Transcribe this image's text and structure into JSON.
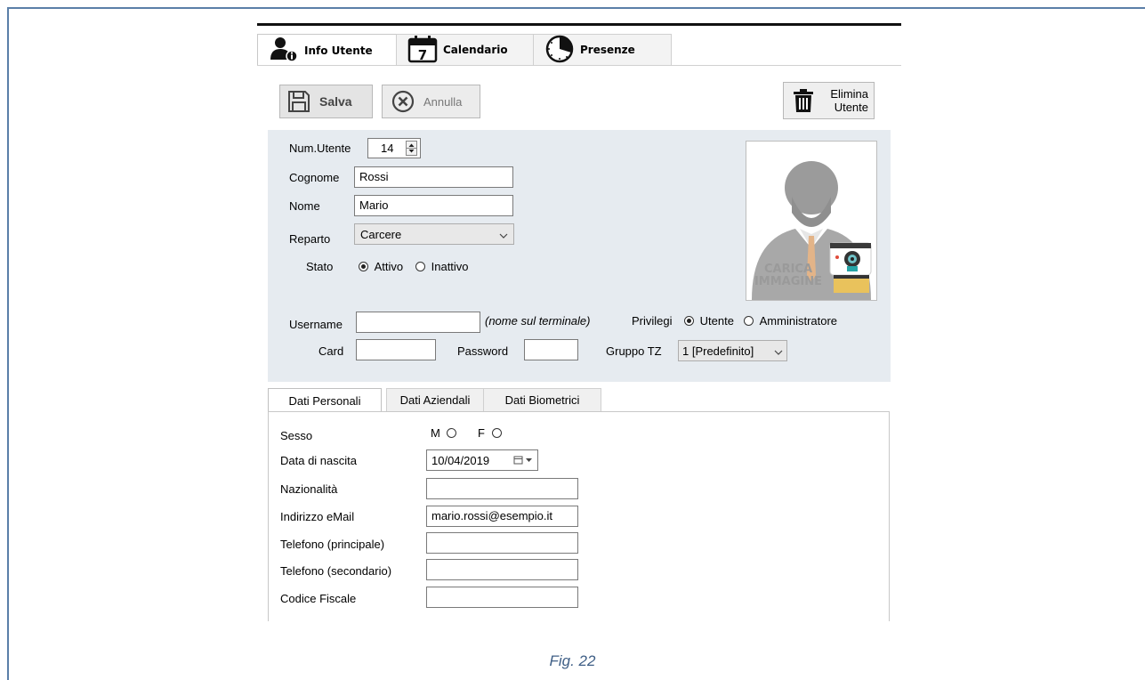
{
  "colors": {
    "frame": "#5b7fa8",
    "panel": "#e6ebf0",
    "caption": "#3f5f86"
  },
  "main_tabs": [
    {
      "label": "Info Utente",
      "icon": "user-info-icon",
      "active": true
    },
    {
      "label": "Calendario",
      "icon": "calendar-icon",
      "active": false,
      "icon_text": "7"
    },
    {
      "label": "Presenze",
      "icon": "clock-icon",
      "active": false
    }
  ],
  "toolbar": {
    "save_label": "Salva",
    "cancel_label": "Annulla",
    "delete_label_line1": "Elimina",
    "delete_label_line2": "Utente"
  },
  "user_form": {
    "num_utente_label": "Num.Utente",
    "num_utente_value": "14",
    "cognome_label": "Cognome",
    "cognome_value": "Rossi",
    "nome_label": "Nome",
    "nome_value": "Mario",
    "reparto_label": "Reparto",
    "reparto_value": "Carcere",
    "stato_label": "Stato",
    "stato_options": [
      "Attivo",
      "Inattivo"
    ],
    "stato_selected": "Attivo",
    "username_label": "Username",
    "username_value": "",
    "username_hint": "(nome sul terminale)",
    "privilegi_label": "Privilegi",
    "privilegi_options": [
      "Utente",
      "Amministratore"
    ],
    "privilegi_selected": "Utente",
    "card_label": "Card",
    "card_value": "",
    "password_label": "Password",
    "password_value": "",
    "gruppo_tz_label": "Gruppo TZ",
    "gruppo_tz_value": "1 [Predefinito]"
  },
  "photo": {
    "line1": "CARICA",
    "line2": "IMMAGINE"
  },
  "sub_tabs": [
    "Dati Personali",
    "Dati Aziendali",
    "Dati Biometrici"
  ],
  "personal": {
    "sesso_label": "Sesso",
    "sesso_options": [
      "M",
      "F"
    ],
    "nascita_label": "Data di nascita",
    "nascita_value": "10/04/2019",
    "nazionalita_label": "Nazionalità",
    "nazionalita_value": "",
    "email_label": "Indirizzo eMail",
    "email_value": "mario.rossi@esempio.it",
    "tel1_label": "Telefono (principale)",
    "tel1_value": "",
    "tel2_label": "Telefono (secondario)",
    "tel2_value": "",
    "cf_label": "Codice Fiscale",
    "cf_value": ""
  },
  "caption": "Fig. 22"
}
